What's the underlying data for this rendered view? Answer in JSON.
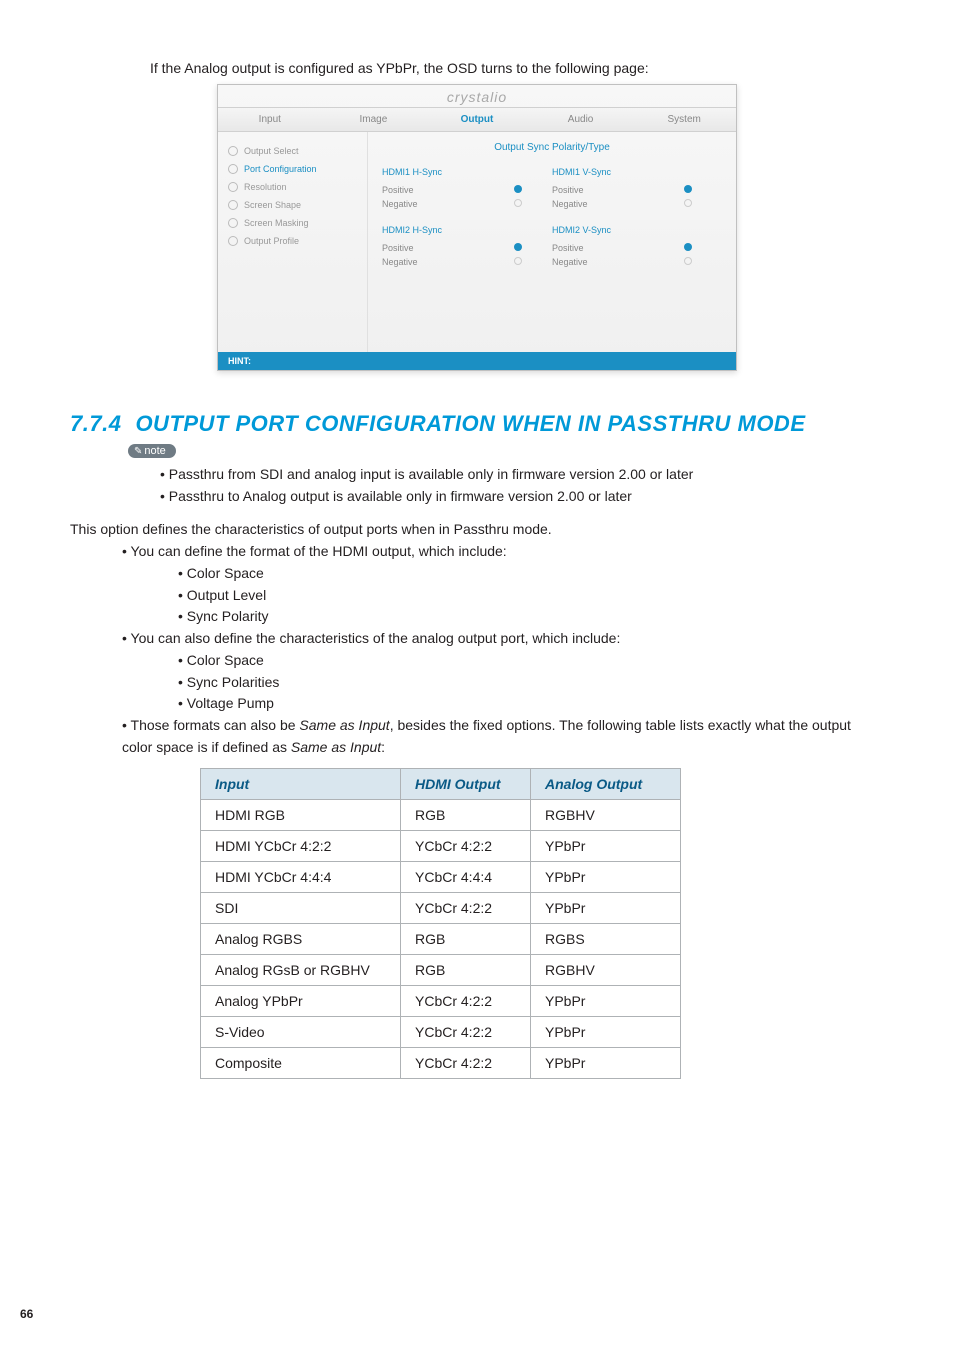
{
  "intro": "If the Analog output is configured as YPbPr, the OSD turns to the following page:",
  "osd": {
    "logo": "crystalio",
    "tabs": [
      "Input",
      "Image",
      "Output",
      "Audio",
      "System"
    ],
    "active_tab": "Output",
    "side_items": [
      "Output Select",
      "Port Configuration",
      "Resolution",
      "Screen Shape",
      "Screen Masking",
      "Output Profile"
    ],
    "side_selected": "Port Configuration",
    "panel_title": "Output Sync Polarity/Type",
    "groups": [
      {
        "left_header": "HDMI1 H-Sync",
        "right_header": "HDMI1 V-Sync",
        "left_opts": [
          {
            "label": "Positive",
            "on": true
          },
          {
            "label": "Negative",
            "on": false
          }
        ],
        "right_opts": [
          {
            "label": "Positive",
            "on": true
          },
          {
            "label": "Negative",
            "on": false
          }
        ]
      },
      {
        "left_header": "HDMI2 H-Sync",
        "right_header": "HDMI2 V-Sync",
        "left_opts": [
          {
            "label": "Positive",
            "on": true
          },
          {
            "label": "Negative",
            "on": false
          }
        ],
        "right_opts": [
          {
            "label": "Positive",
            "on": true
          },
          {
            "label": "Negative",
            "on": false
          }
        ]
      }
    ],
    "hint": "HINT:"
  },
  "section": {
    "num": "7.7.4",
    "title": "OUTPUT PORT CONFIGURATION WHEN IN PASSTHRU MODE",
    "note_label": "note",
    "note_bullets": [
      "Passthru from SDI and analog input is available only in firmware version 2.00 or later",
      "Passthru to Analog output is available only in firmware version 2.00 or later"
    ],
    "para": "This option defines the characteristics of output ports when in Passthru mode.",
    "bullets": [
      {
        "text": "You can define the format of the HDMI output, which include:",
        "sub": [
          "Color Space",
          "Output Level",
          "Sync Polarity"
        ]
      },
      {
        "text": "You can also define the characteristics of the analog output port, which include:",
        "sub": [
          "Color Space",
          "Sync Polarities",
          "Voltage Pump"
        ]
      },
      {
        "text_pre": "Those formats can also be ",
        "em1": "Same as Input",
        "text_mid": ", besides the fixed options. The following table lists exactly what the output color space is if defined as ",
        "em2": "Same as Input",
        "text_post": ":"
      }
    ]
  },
  "table": {
    "headers": [
      "Input",
      "HDMI Output",
      "Analog Output"
    ],
    "rows": [
      [
        "HDMI RGB",
        "RGB",
        "RGBHV"
      ],
      [
        "HDMI YCbCr 4:2:2",
        "YCbCr 4:2:2",
        "YPbPr"
      ],
      [
        "HDMI YCbCr 4:4:4",
        "YCbCr 4:4:4",
        "YPbPr"
      ],
      [
        "SDI",
        "YCbCr 4:2:2",
        "YPbPr"
      ],
      [
        "Analog RGBS",
        "RGB",
        "RGBS"
      ],
      [
        "Analog RGsB or RGBHV",
        "RGB",
        "RGBHV"
      ],
      [
        "Analog YPbPr",
        "YCbCr 4:2:2",
        "YPbPr"
      ],
      [
        "S-Video",
        "YCbCr 4:2:2",
        "YPbPr"
      ],
      [
        "Composite",
        "YCbCr 4:2:2",
        "YPbPr"
      ]
    ]
  },
  "page_number": "66"
}
